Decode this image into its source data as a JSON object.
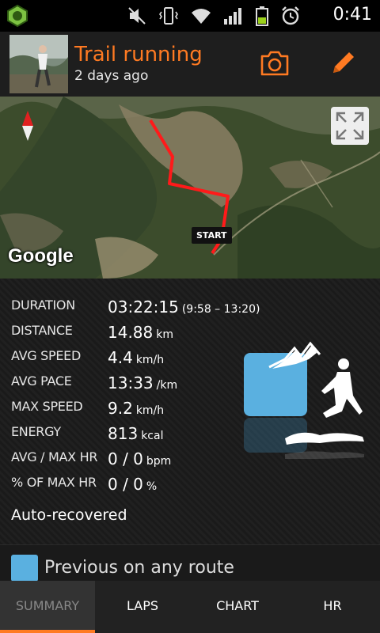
{
  "statusbar": {
    "time": "0:41",
    "icons": [
      "app-icon",
      "mute-icon",
      "vibrate-icon",
      "wifi-icon",
      "signal-icon",
      "battery-icon",
      "alarm-icon"
    ]
  },
  "header": {
    "title": "Trail running",
    "subtitle": "2 days ago",
    "actions": [
      "camera-icon",
      "pencil-icon"
    ]
  },
  "map": {
    "provider_label": "Google",
    "marker_label": "START"
  },
  "stats": [
    {
      "label": "DURATION",
      "value": "03:22:15",
      "unit": "",
      "extra": "(9:58 – 13:20)"
    },
    {
      "label": "DISTANCE",
      "value": "14.88",
      "unit": "km",
      "extra": ""
    },
    {
      "label": "AVG SPEED",
      "value": "4.4",
      "unit": "km/h",
      "extra": ""
    },
    {
      "label": "AVG PACE",
      "value": "13:33",
      "unit": "/km",
      "extra": ""
    },
    {
      "label": "MAX SPEED",
      "value": "9.2",
      "unit": "km/h",
      "extra": ""
    },
    {
      "label": "ENERGY",
      "value": "813",
      "unit": "kcal",
      "extra": ""
    },
    {
      "label": "AVG / MAX HR",
      "value": "0 / 0",
      "unit": "bpm",
      "extra": ""
    },
    {
      "label": "% OF MAX HR",
      "value": "0 / 0",
      "unit": "%",
      "extra": ""
    }
  ],
  "auto_recovered": "Auto-recovered",
  "previous": {
    "label": "Previous on any route"
  },
  "tabs": [
    {
      "label": "SUMMARY",
      "active": true
    },
    {
      "label": "LAPS",
      "active": false
    },
    {
      "label": "CHART",
      "active": false
    },
    {
      "label": "HR",
      "active": false
    }
  ],
  "colors": {
    "accent": "#ff7a22",
    "route": "#ff1a1a",
    "tile": "#5ab0e0"
  }
}
